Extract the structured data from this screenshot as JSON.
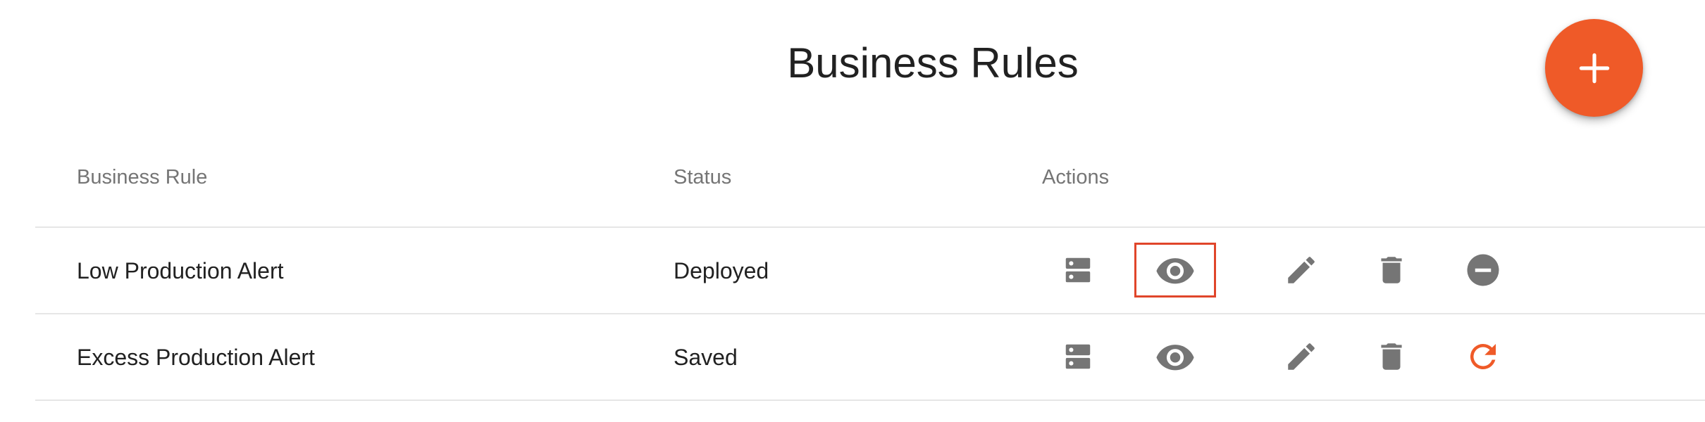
{
  "page": {
    "title": "Business Rules"
  },
  "fab": {
    "icon": "plus-icon",
    "color": "#ef5a28"
  },
  "table": {
    "columns": [
      "Business Rule",
      "Status",
      "Actions"
    ],
    "rows": [
      {
        "name": "Low Production Alert",
        "status": "Deployed",
        "actions": [
          "server-icon",
          "eye-icon",
          "edit-icon",
          "delete-icon",
          "undeploy-icon"
        ],
        "highlighted_action": "eye-icon"
      },
      {
        "name": "Excess Production Alert",
        "status": "Saved",
        "actions": [
          "server-icon",
          "eye-icon",
          "edit-icon",
          "delete-icon",
          "redeploy-icon"
        ],
        "highlighted_action": null
      }
    ]
  },
  "colors": {
    "accent": "#ef5a28",
    "icon_gray": "#757575",
    "highlight_border": "#e0452a",
    "divider": "#e6e6e6"
  }
}
